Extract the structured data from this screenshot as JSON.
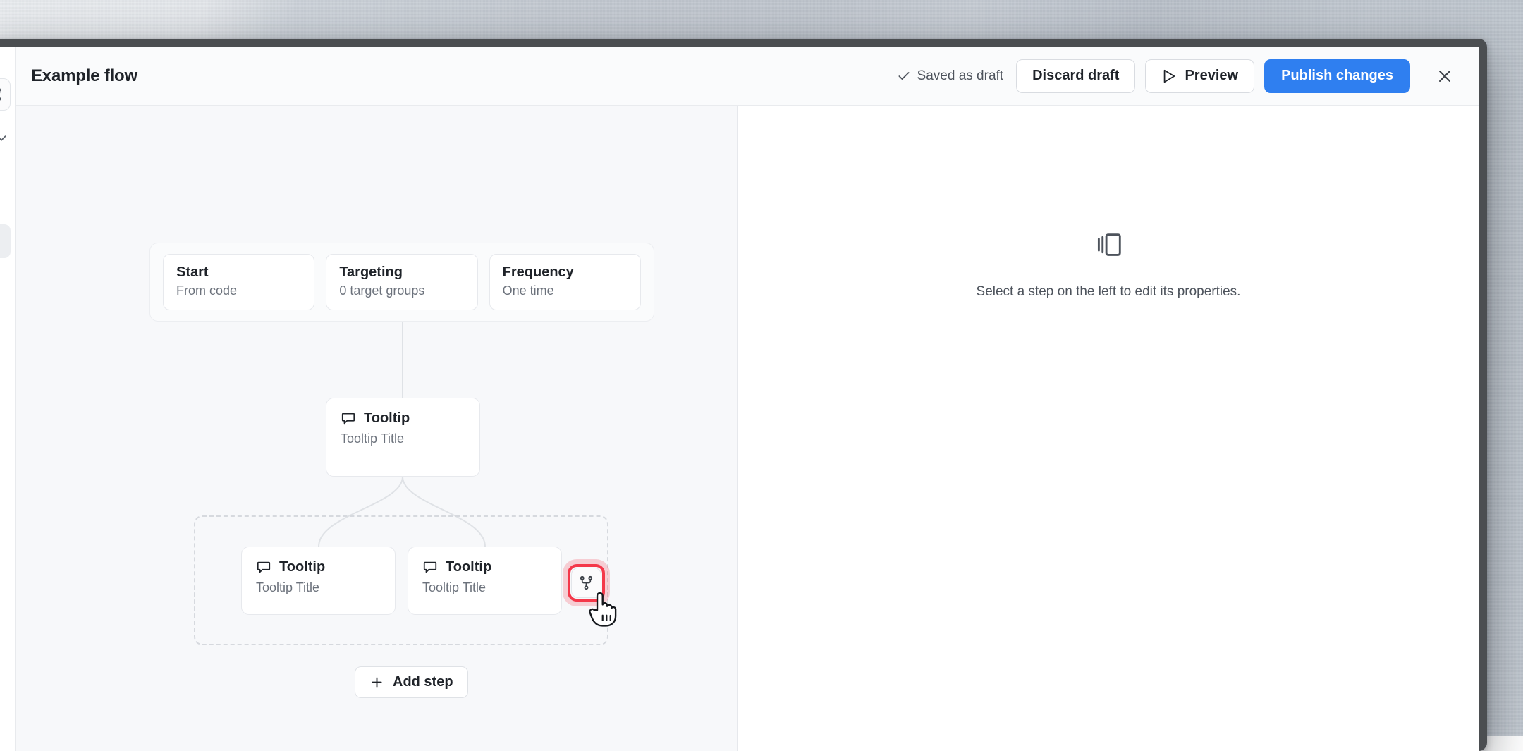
{
  "window": {
    "sidebar": {
      "gear_icon": "gear-icon",
      "chevron_icon": "chevron-down-icon"
    }
  },
  "header": {
    "title": "Example flow",
    "saved_status": "Saved as draft",
    "saved_icon": "check-icon",
    "discard_label": "Discard draft",
    "preview_label": "Preview",
    "preview_icon": "play-triangle-icon",
    "publish_label": "Publish changes",
    "close_icon": "close-icon",
    "primary_color": "#2f7ff0"
  },
  "canvas": {
    "head_cards": [
      {
        "title": "Start",
        "subtitle": "From code"
      },
      {
        "title": "Targeting",
        "subtitle": "0 target groups"
      },
      {
        "title": "Frequency",
        "subtitle": "One time"
      }
    ],
    "root_step": {
      "title": "Tooltip",
      "subtitle": "Tooltip Title",
      "icon": "tooltip-bubble-icon"
    },
    "branch_steps": [
      {
        "title": "Tooltip",
        "subtitle": "Tooltip Title",
        "icon": "tooltip-bubble-icon"
      },
      {
        "title": "Tooltip",
        "subtitle": "Tooltip Title",
        "icon": "tooltip-bubble-icon"
      }
    ],
    "branch_split_button": {
      "icon": "branch-split-icon",
      "highlight_color": "#f4384a"
    },
    "add_step": {
      "label": "Add step",
      "icon": "plus-icon"
    }
  },
  "properties_panel": {
    "empty_icon": "layers-stack-icon",
    "empty_text": "Select a step on the left to edit its properties."
  }
}
